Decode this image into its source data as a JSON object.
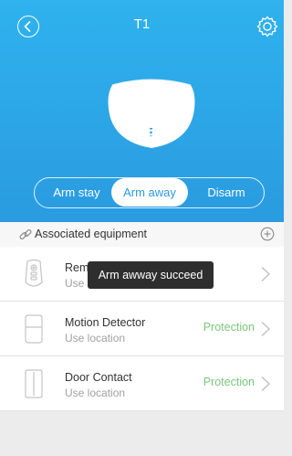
{
  "header": {
    "title": "T1"
  },
  "modes": [
    {
      "label": "Arm stay",
      "active": false
    },
    {
      "label": "Arm away",
      "active": true
    },
    {
      "label": "Disarm",
      "active": false
    }
  ],
  "associated": {
    "label": "Associated equipment"
  },
  "devices": [
    {
      "name": "Remote Controller",
      "sub": "Use location",
      "status": "",
      "icon": "remote-controller-icon"
    },
    {
      "name": "Motion Detector",
      "sub": "Use location",
      "status": "Protection",
      "icon": "motion-detector-icon"
    },
    {
      "name": "Door Contact",
      "sub": "Use location",
      "status": "Protection",
      "icon": "door-contact-icon"
    }
  ],
  "toast": {
    "text": "Arm awway succeed"
  },
  "colors": {
    "header_bg": "#2a9be0",
    "protection": "#7bc67c"
  }
}
